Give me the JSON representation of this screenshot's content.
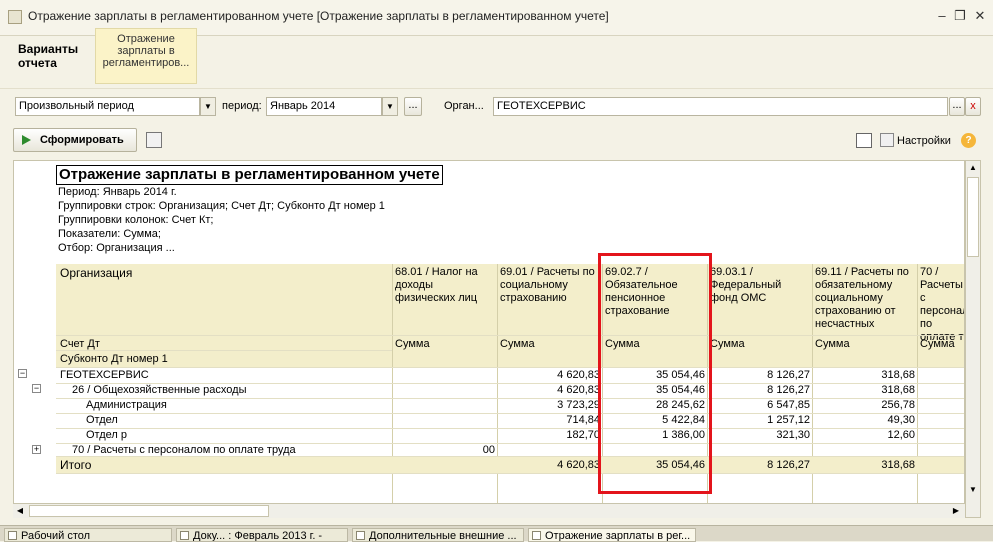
{
  "window": {
    "title": "Отражение зарплаты в регламентированном учете [Отражение зарплаты в регламентированном учете]"
  },
  "tabs": {
    "variants": "Варианты отчета",
    "report": "Отражение зарплаты в регламентиров..."
  },
  "filters": {
    "period_type": "Произвольный период",
    "period_label": "период:",
    "period_value": "Январь 2014",
    "org_label": "Орган...",
    "org_value": "ГЕОТЕХСЕРВИС",
    "ellipsis": "...",
    "clear": "x"
  },
  "toolbar": {
    "run_label": "Сформировать",
    "settings_label": "Настройки",
    "help_label": "?"
  },
  "report": {
    "title": "Отражение зарплаты в регламентированном учете",
    "period_line": "Период: Январь 2014 г.",
    "rows_group_line": "Группировки строк: Организация; Счет Дт; Субконто Дт номер 1",
    "cols_group_line": "Группировки колонок: Счет Кт;",
    "measures_line": "Показатели: Сумма;",
    "filter_line": "Отбор: Организация ..."
  },
  "table": {
    "header_org": "Организация",
    "header_account": "Счет Дт",
    "header_subconto": "Субконто Дт номер 1",
    "columns": [
      "68.01 / Налог на доходы физических лиц",
      "69.01 / Расчеты по социальному страхованию",
      "69.02.7 / Обязательное пенсионное страхование",
      "69.03.1 / Федеральный фонд ОМС",
      "69.11 / Расчеты по обязательному социальному страхованию от несчастных",
      "70 / Расчеты с персоналом по оплате т"
    ],
    "measure": "Сумма",
    "rows": [
      {
        "label": "ГЕОТЕХСЕРВИС",
        "values": [
          "",
          "4 620,83",
          "35 054,46",
          "8 126,27",
          "318,68",
          ""
        ]
      },
      {
        "label": "26 / Общехозяйственные расходы",
        "values": [
          "",
          "4 620,83",
          "35 054,46",
          "8 126,27",
          "318,68",
          ""
        ]
      },
      {
        "label": "Администрация",
        "values": [
          "",
          "3 723,29",
          "28 245,62",
          "6 547,85",
          "256,78",
          ""
        ]
      },
      {
        "label": "Отдел",
        "values": [
          "",
          "714,84",
          "5 422,84",
          "1 257,12",
          "49,30",
          ""
        ]
      },
      {
        "label": "Отдел р",
        "values": [
          "",
          "182,70",
          "1 386,00",
          "321,30",
          "12,60",
          ""
        ]
      },
      {
        "label": "70 / Расчеты с персоналом по оплате труда",
        "values": [
          "00",
          "",
          "",
          "",
          "",
          ""
        ]
      }
    ],
    "total_label": "Итого",
    "total_values": [
      "",
      "4 620,83",
      "35 054,46",
      "8 126,27",
      "318,68",
      ""
    ]
  },
  "taskbar": [
    "Рабочий стол",
    "Доку... : Февраль 2013 г. -",
    "Дополнительные внешние ...",
    "Отражение зарплаты в рег..."
  ],
  "colors": {
    "highlight_box": "#e3141b",
    "header_bg": "#f3eecb",
    "active_tab_bg": "#fbf3c8"
  }
}
